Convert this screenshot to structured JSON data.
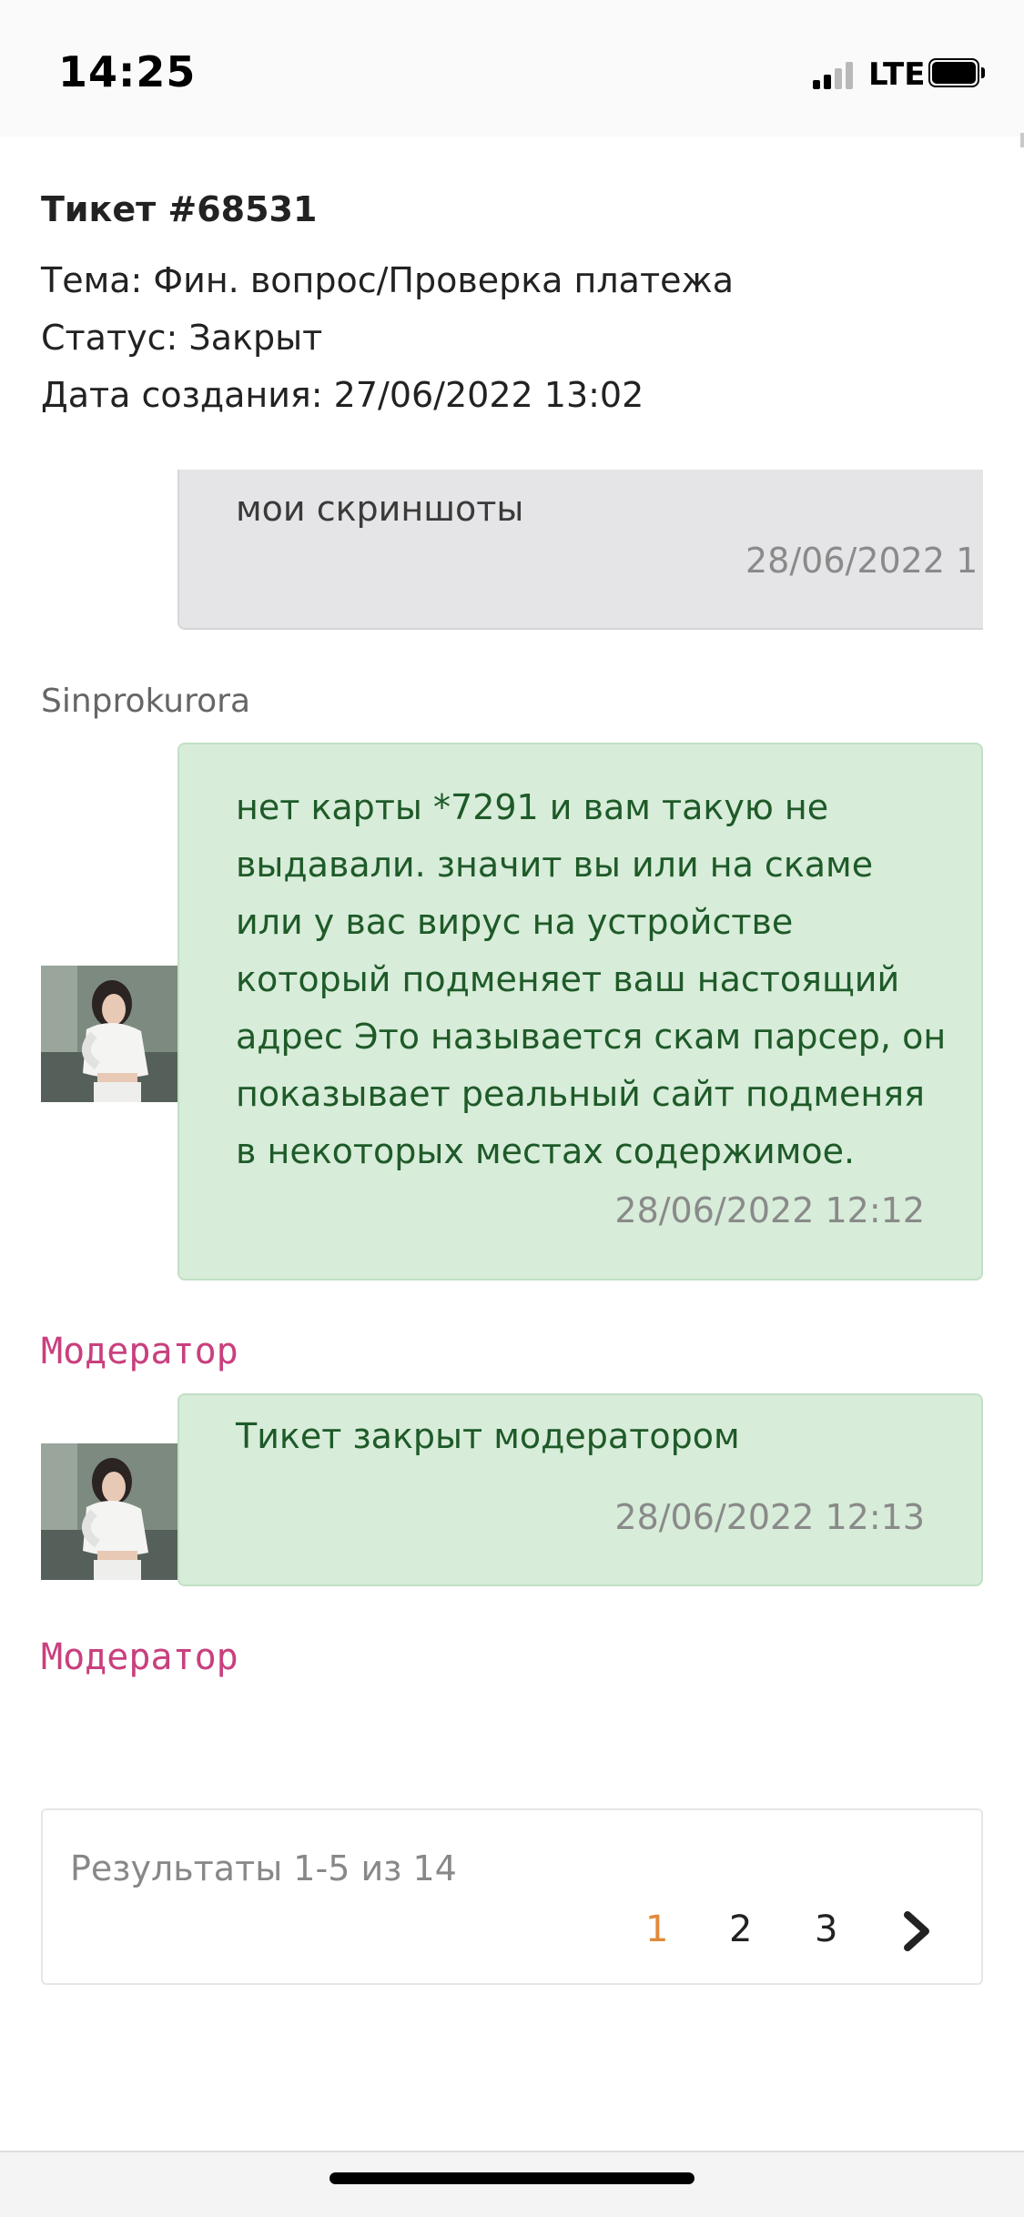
{
  "status_bar": {
    "time": "14:25",
    "network": "LTE"
  },
  "ticket": {
    "title": "Тикет #68531",
    "topic": "Тема: Фин. вопрос/Проверка платежа",
    "status": "Статус: Закрыт",
    "created": "Дата создания: 27/06/2022 13:02"
  },
  "messages": [
    {
      "lines": [
        "мои скриншоты"
      ],
      "time": "28/06/2022 1"
    },
    {
      "author": "Sinprokurora",
      "lines": [
        "нет карты *7291 и вам такую не",
        "выдавали. значит вы или на скаме",
        "или у вас вирус на устройстве",
        "который подменяет ваш настоящий",
        "адрес Это называется скам парсер, он",
        "показывает реальный сайт подменяя",
        "в некоторых местах содержимое."
      ],
      "time": "28/06/2022 12:12",
      "author_after": "Модератор"
    },
    {
      "lines": [
        "Тикет закрыт модератором"
      ],
      "time": "28/06/2022 12:13",
      "author_after": "Модератор"
    }
  ],
  "pagination": {
    "results": "Результаты 1-5 из 14",
    "pages": [
      "1",
      "2",
      "3"
    ],
    "current_page": "1"
  },
  "colors": {
    "moderator": "#c9407e",
    "current_page": "#e08a3c",
    "green_bubble": "#d7ecd9",
    "green_text": "#1e5a28",
    "gray_bubble": "#e5e5e7"
  },
  "icons": {
    "next_page": "chevron-right-icon",
    "signal": "cellular-signal-icon",
    "battery": "battery-icon"
  }
}
